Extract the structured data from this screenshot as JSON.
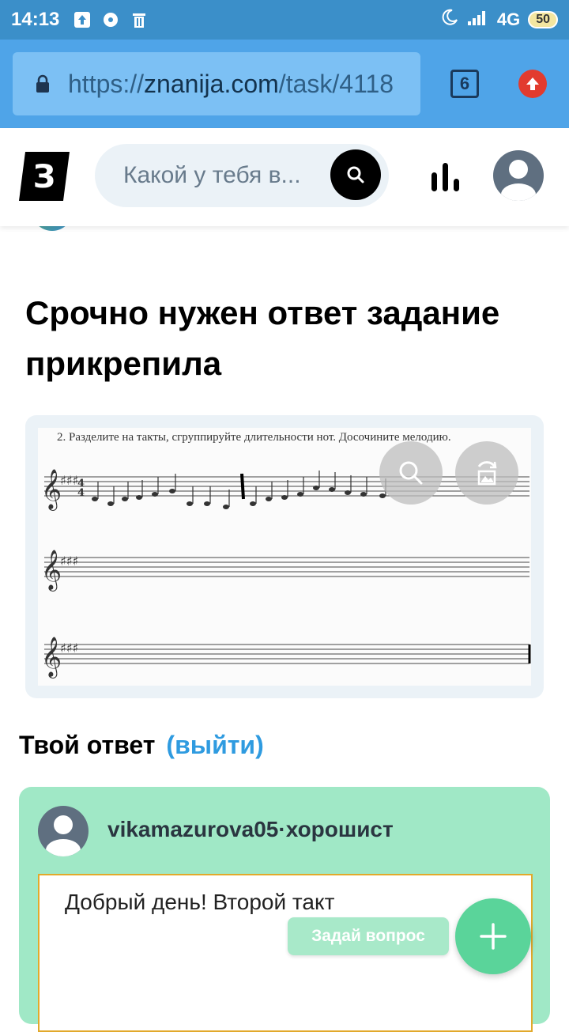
{
  "status_bar": {
    "time": "14:13",
    "network": "4G",
    "battery": "50"
  },
  "browser": {
    "url_prefix": "https://",
    "url_host": "znanija.com",
    "url_path": "/task/4118",
    "tab_count": "6"
  },
  "header": {
    "logo_letter": "З",
    "search_placeholder": "Какой у тебя в..."
  },
  "question": {
    "title": "Срочно нужен ответ задание прикрепила",
    "attachment_caption": "2. Разделите на такты, сгруппируйте длительности нот. Досочините мелодию."
  },
  "answer": {
    "heading": "Твой ответ",
    "logout_label": "(выйти)",
    "username": "vikamazurova05",
    "separator": "·",
    "rank": "хорошист",
    "text": "Добрый день! Второй такт"
  },
  "actions": {
    "ask_label": "Задай вопрос"
  },
  "colors": {
    "status_bar": "#3b8fc9",
    "browser_bar": "#4fa4e8",
    "answer_card": "#a0e8c6",
    "accent_link": "#2f9be0",
    "fab": "#5ad49a"
  }
}
